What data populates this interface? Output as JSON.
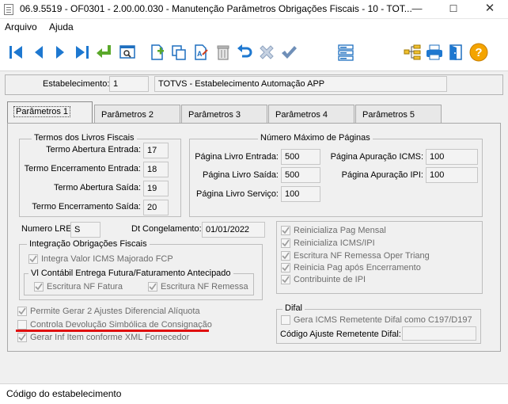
{
  "window": {
    "title": "06.9.5519 - OF0301 - 2.00.00.030 - Manutenção Parâmetros Obrigações Fiscais - 10 - TOT..."
  },
  "menu": {
    "items": [
      "Arquivo",
      "Ajuda"
    ]
  },
  "header": {
    "estabelecimento_label": "Estabelecimento:",
    "estabelecimento_code": "1",
    "estabelecimento_name": "TOTVS - Estabelecimento Automação APP"
  },
  "tabs": [
    "Parâmetros 1",
    "Parâmetros 2",
    "Parâmetros 3",
    "Parâmetros 4",
    "Parâmetros 5"
  ],
  "termos": {
    "title": "Termos dos Livros Fiscais",
    "rows": [
      {
        "label": "Termo Abertura Entrada:",
        "value": "17"
      },
      {
        "label": "Termo Encerramento Entrada:",
        "value": "18"
      },
      {
        "label": "Termo Abertura Saída:",
        "value": "19"
      },
      {
        "label": "Termo Encerramento Saída:",
        "value": "20"
      }
    ]
  },
  "paginas": {
    "title": "Número Máximo de Páginas",
    "left": [
      {
        "label": "Página Livro Entrada:",
        "value": "500"
      },
      {
        "label": "Página Livro Saída:",
        "value": "500"
      },
      {
        "label": "Página Livro Serviço:",
        "value": "100"
      }
    ],
    "right": [
      {
        "label": "Página  Apuração ICMS:",
        "value": "100"
      },
      {
        "label": "Página  Apuração IPI:",
        "value": "100"
      }
    ]
  },
  "lre": {
    "label": "Numero LRE:",
    "value": "S"
  },
  "congelamento": {
    "label": "Dt Congelamento:",
    "value": "01/01/2022"
  },
  "integracao": {
    "title": "Integração Obrigações Fiscais",
    "integra_icms": "Integra Valor ICMS Majorado FCP",
    "vl_contabil_title": "Vl Contábil Entrega Futura/Faturamento Antecipado",
    "escritura_fatura": "Escritura NF Fatura",
    "escritura_remessa": "Escritura NF Remessa"
  },
  "right_checks": [
    "Reinicializa Pag Mensal",
    "Reinicializa ICMS/IPI",
    "Escritura NF Remessa Oper Triang",
    "Reinicia Pag após Encerramento",
    "Contribuinte de IPI"
  ],
  "bottom_checks": [
    "Permite Gerar 2 Ajustes Diferencial Alíquota",
    "Controla Devolução Simbólica de Consignação",
    "Gerar Inf Item conforme XML Fornecedor"
  ],
  "difal": {
    "title": "Difal",
    "gera_icms": "Gera ICMS Remetente Difal como C197/D197",
    "codigo_label": "Código Ajuste Remetente Difal:",
    "codigo_value": ""
  },
  "status": {
    "text": "Código do estabelecimento"
  },
  "colors": {
    "toolbar_blue": "#1e78d0",
    "green_arrow": "#5aa82a",
    "annotation_red": "#e01010",
    "help_orange": "#f4a400"
  }
}
